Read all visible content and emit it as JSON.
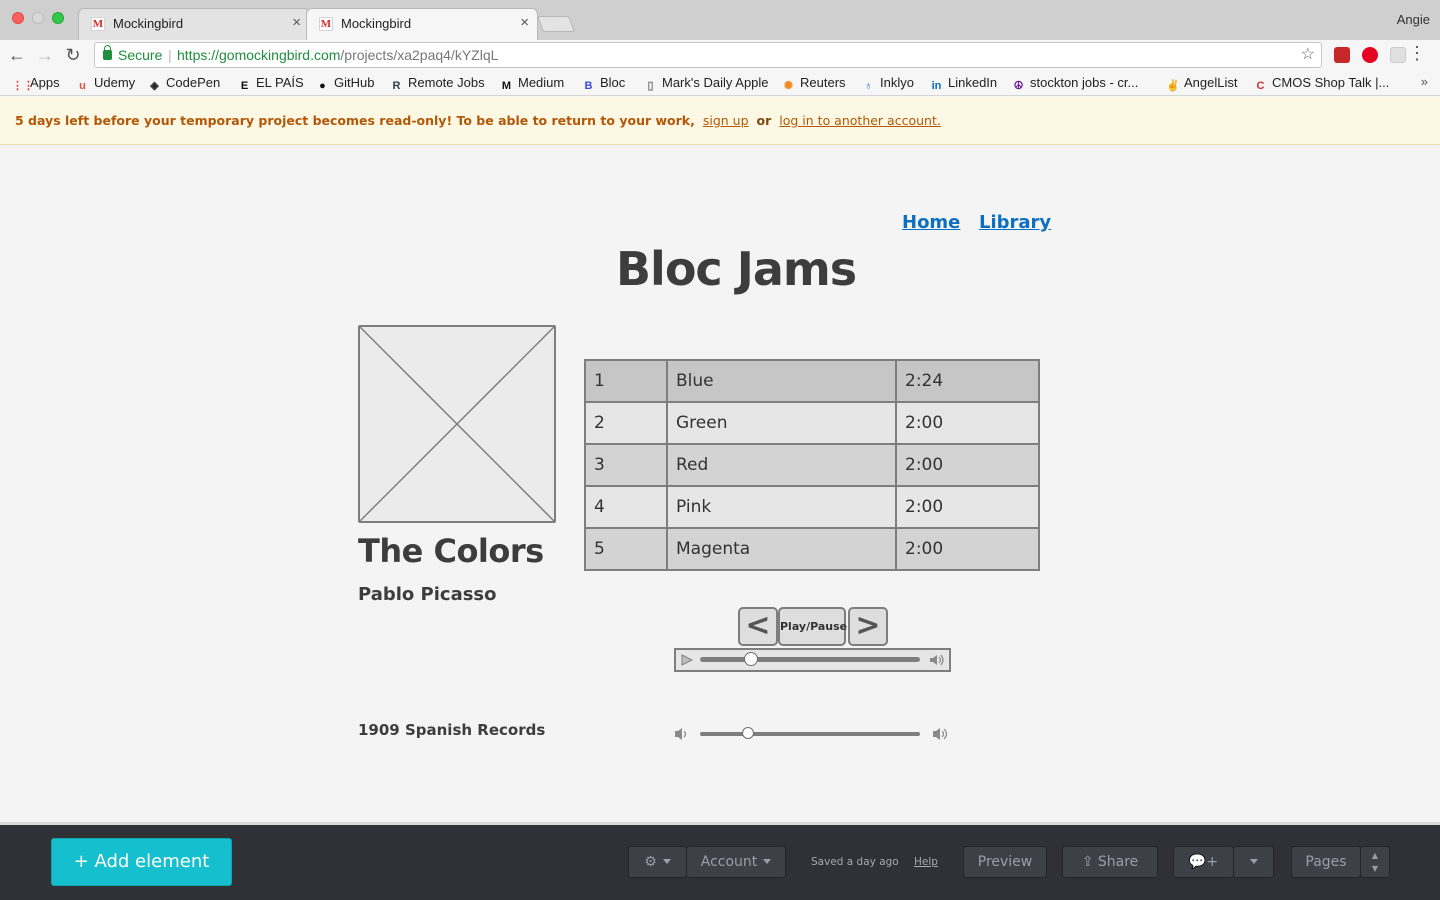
{
  "browser": {
    "tabs": [
      {
        "label": "Mockingbird",
        "favicon": "M"
      },
      {
        "label": "Mockingbird",
        "favicon": "M"
      }
    ],
    "profile_name": "Angie",
    "secure_label": "Secure",
    "url_host": "https://gomockingbird.com",
    "url_path": "/projects/xa2paq4/kYZlqL",
    "bookmarks": [
      {
        "label": "Apps",
        "icon": "apps-grid-icon",
        "glyph": "⋮⋮",
        "color": "#e94235"
      },
      {
        "label": "Udemy",
        "icon": "udemy-icon",
        "glyph": "u",
        "color": "#e1503b"
      },
      {
        "label": "CodePen",
        "icon": "codepen-icon",
        "glyph": "◈",
        "color": "#222222"
      },
      {
        "label": "EL PAÍS",
        "icon": "el-pais-icon",
        "glyph": "E",
        "color": "#111111"
      },
      {
        "label": "GitHub",
        "icon": "github-icon",
        "glyph": "●",
        "color": "#111111"
      },
      {
        "label": "Remote Jobs",
        "icon": "remote-jobs-icon",
        "glyph": "R",
        "color": "#2c3e50"
      },
      {
        "label": "Medium",
        "icon": "medium-icon",
        "glyph": "M",
        "color": "#111111"
      },
      {
        "label": "Bloc",
        "icon": "bloc-icon",
        "glyph": "B",
        "color": "#3b4cd9"
      },
      {
        "label": "Mark's Daily Apple",
        "icon": "page-icon",
        "glyph": "▯",
        "color": "#777777"
      },
      {
        "label": "Reuters",
        "icon": "reuters-icon",
        "glyph": "✺",
        "color": "#f08a24"
      },
      {
        "label": "Inklyo",
        "icon": "inklyo-icon",
        "glyph": "♁",
        "color": "#2a7bd1"
      },
      {
        "label": "LinkedIn",
        "icon": "linkedin-icon",
        "glyph": "in",
        "color": "#0a66c2"
      },
      {
        "label": "stockton jobs - cr...",
        "icon": "craigslist-icon",
        "glyph": "☮",
        "color": "#6a1b9a"
      },
      {
        "label": "AngelList",
        "icon": "angellist-icon",
        "glyph": "✌",
        "color": "#222222"
      },
      {
        "label": "CMOS Shop Talk |...",
        "icon": "cmos-icon",
        "glyph": "C",
        "color": "#d32f2f"
      }
    ]
  },
  "banner": {
    "message": "5 days left before your temporary project becomes read-only! To be able to return to your work,",
    "signup_link": "sign up",
    "or_text": "or",
    "login_link": "log in to another account."
  },
  "wireframe": {
    "nav": {
      "home": "Home",
      "library": "Library"
    },
    "app_title": "Bloc Jams",
    "album": {
      "title": "The Colors",
      "artist": "Pablo Picasso",
      "label": "1909 Spanish Records"
    },
    "songs": [
      {
        "number": "1",
        "title": "Blue",
        "duration": "2:24"
      },
      {
        "number": "2",
        "title": "Green",
        "duration": "2:00"
      },
      {
        "number": "3",
        "title": "Red",
        "duration": "2:00"
      },
      {
        "number": "4",
        "title": "Pink",
        "duration": "2:00"
      },
      {
        "number": "5",
        "title": "Magenta",
        "duration": "2:00"
      }
    ],
    "controls": {
      "previous": "<",
      "play_pause": "Play/Pause",
      "next": ">"
    },
    "seek_position": 0.23,
    "volume_level": 0.22
  },
  "bottom_bar": {
    "add_element": "+ Add element",
    "account": "Account",
    "saved_status": "Saved a day ago",
    "help": "Help",
    "preview": "Preview",
    "share": "Share",
    "comment_add": "+",
    "pages": "Pages"
  },
  "colors": {
    "accent": "#15bfcd",
    "link": "#0d6fc0",
    "banner_text": "#b35808",
    "banner_bg": "#fcf8e3",
    "bottom_bar_bg": "#2f3137"
  }
}
